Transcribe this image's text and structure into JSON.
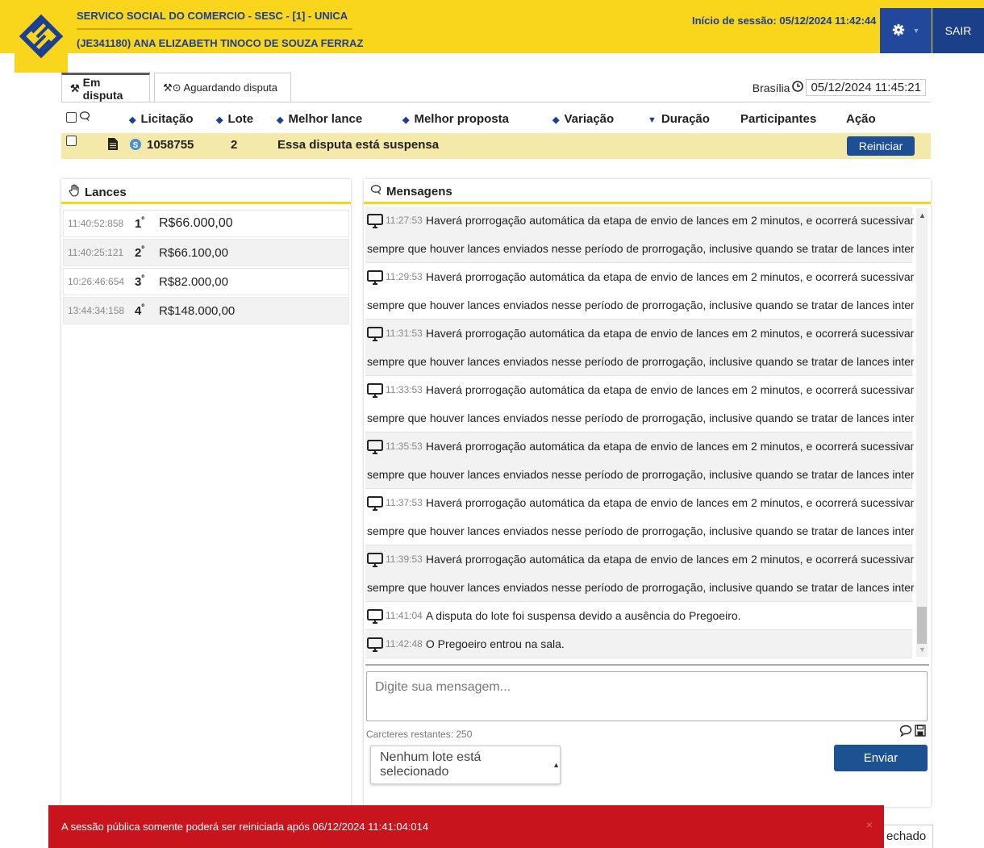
{
  "header": {
    "org": "SERVICO SOCIAL DO COMERCIO - SESC - [1] - UNICA",
    "user": "(JE341180) ANA ELIZABETH TINOCO DE SOUZA FERRAZ",
    "session_start": "Início de sessão: 05/12/2024 11:42:44",
    "logout": "SAIR",
    "settings_icon": "gear-icon",
    "brand_color": "#f9d51c",
    "primary_color": "#1c3f94"
  },
  "tabs": [
    {
      "label": "Em disputa",
      "icon": "gavel-icon",
      "active": true
    },
    {
      "label": "Aguardando disputa",
      "icon": "gavel-clock-icon",
      "active": false
    }
  ],
  "clock": {
    "city": "Brasília",
    "datetime": "05/12/2024 11:45:21"
  },
  "table": {
    "columns": [
      "Licitação",
      "Lote",
      "Melhor lance",
      "Melhor proposta",
      "Variação",
      "Duração",
      "Participantes",
      "Ação"
    ],
    "row": {
      "licitacao": "1058755",
      "lote": "2",
      "status": "Essa disputa está suspensa",
      "action": "Reiniciar"
    }
  },
  "lances": {
    "title": "Lances",
    "items": [
      {
        "time": "11:40:52:858",
        "rank": "1",
        "value": "R$66.000,00"
      },
      {
        "time": "11:40:25:121",
        "rank": "2",
        "value": "R$66.100,00"
      },
      {
        "time": "10:26:46:654",
        "rank": "3",
        "value": "R$82.000,00"
      },
      {
        "time": "13:44:34:158",
        "rank": "4",
        "value": "R$148.000,00"
      }
    ],
    "rank_suffix": "º"
  },
  "mensagens": {
    "title": "Mensagens",
    "items": [
      {
        "time": "11:27:53",
        "line1": "Haverá prorrogação automática da etapa de envio de lances em 2 minutos, e ocorrerá sucessivamente",
        "line2": "sempre que houver lances enviados nesse período de prorrogação, inclusive quando se tratar de lances intermediários."
      },
      {
        "time": "11:29:53",
        "line1": "Haverá prorrogação automática da etapa de envio de lances em 2 minutos, e ocorrerá sucessivamente",
        "line2": "sempre que houver lances enviados nesse período de prorrogação, inclusive quando se tratar de lances intermediários."
      },
      {
        "time": "11:31:53",
        "line1": "Haverá prorrogação automática da etapa de envio de lances em 2 minutos, e ocorrerá sucessivamente",
        "line2": "sempre que houver lances enviados nesse período de prorrogação, inclusive quando se tratar de lances intermediários."
      },
      {
        "time": "11:33:53",
        "line1": "Haverá prorrogação automática da etapa de envio de lances em 2 minutos, e ocorrerá sucessivamente",
        "line2": "sempre que houver lances enviados nesse período de prorrogação, inclusive quando se tratar de lances intermediários."
      },
      {
        "time": "11:35:53",
        "line1": "Haverá prorrogação automática da etapa de envio de lances em 2 minutos, e ocorrerá sucessivamente",
        "line2": "sempre que houver lances enviados nesse período de prorrogação, inclusive quando se tratar de lances intermediários."
      },
      {
        "time": "11:37:53",
        "line1": "Haverá prorrogação automática da etapa de envio de lances em 2 minutos, e ocorrerá sucessivamente",
        "line2": "sempre que houver lances enviados nesse período de prorrogação, inclusive quando se tratar de lances intermediários."
      },
      {
        "time": "11:39:53",
        "line1": "Haverá prorrogação automática da etapa de envio de lances em 2 minutos, e ocorrerá sucessivamente",
        "line2": "sempre que houver lances enviados nesse período de prorrogação, inclusive quando se tratar de lances intermediários."
      },
      {
        "time": "11:41:04",
        "line1": "A disputa do lote foi suspensa devido a ausência do Pregoeiro.",
        "line2": ""
      },
      {
        "time": "11:42:48",
        "line1": "O Pregoeiro entrou na sala.",
        "line2": ""
      }
    ],
    "input_placeholder": "Digite sua mensagem...",
    "remaining": "Carcteres restantes: 250",
    "lot_select": "Nenhum lote está selecionado",
    "send": "Enviar"
  },
  "alert": {
    "text": "A sessão pública somente poderá ser reiniciada após 06/12/2024 11:41:04:014",
    "close": "×",
    "color": "#c8141c"
  },
  "footer_tab": "echado"
}
